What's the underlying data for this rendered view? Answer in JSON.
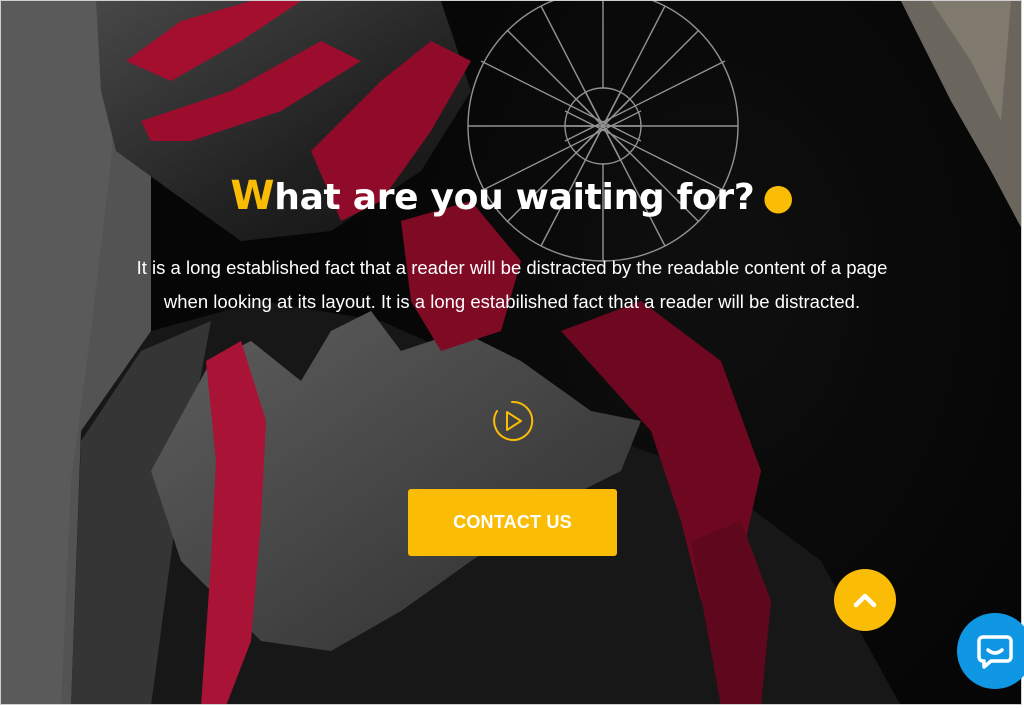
{
  "hero": {
    "headline_first_letter": "W",
    "headline_rest": "hat are you waiting for?",
    "headline_dot": "●",
    "lead": "It is a long established fact that a reader will be distracted by the readable content of a page when looking at its layout. It is a long estabilished fact that a reader will be distracted.",
    "contact_label": "CONTACT US",
    "play_icon": "play-circle-icon",
    "scroll_top_icon": "chevron-up-icon",
    "chat_icon": "chat-bubble-icon"
  },
  "colors": {
    "accent": "#fbbc05",
    "chat": "#0f97e4",
    "text": "#ffffff",
    "background": "#0a0a0a"
  }
}
